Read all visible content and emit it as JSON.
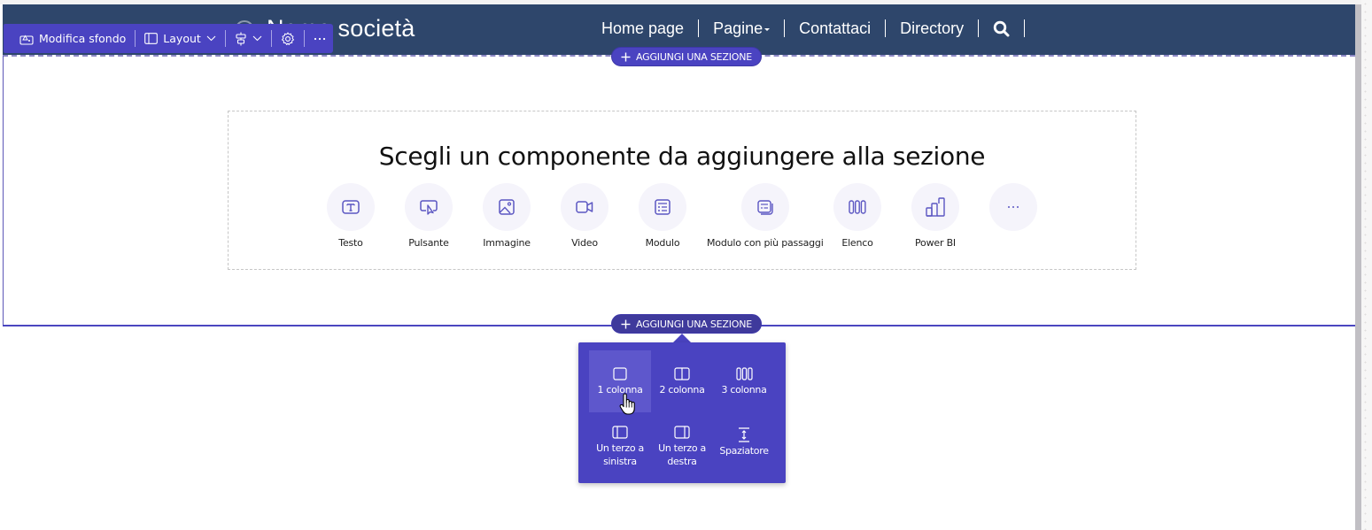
{
  "header": {
    "site_title": "Nome società",
    "site_title_visible": "società",
    "nav": [
      {
        "label": "Home page",
        "has_dropdown": false
      },
      {
        "label": "Pagine",
        "has_dropdown": true
      },
      {
        "label": "Contattaci",
        "has_dropdown": false
      },
      {
        "label": "Directory",
        "has_dropdown": false
      }
    ],
    "search_icon": "search-icon",
    "background_color": "#2e466b"
  },
  "edit_toolbar": {
    "edit_background_label": "Modifica sfondo",
    "layout_label": "Layout",
    "alignment_icon": "alignment-icon",
    "settings_icon": "gear-icon",
    "more_icon": "more-icon",
    "accent_color": "#4a43c1"
  },
  "add_section": {
    "label": "AGGIUNGI UNA SEZIONE"
  },
  "component_picker": {
    "title": "Scegli un componente da aggiungere alla sezione",
    "components": [
      {
        "label": "Testo",
        "icon": "text-icon"
      },
      {
        "label": "Pulsante",
        "icon": "button-icon"
      },
      {
        "label": "Immagine",
        "icon": "image-icon"
      },
      {
        "label": "Video",
        "icon": "video-icon"
      },
      {
        "label": "Modulo",
        "icon": "form-icon"
      },
      {
        "label": "Modulo con più passaggi",
        "icon": "multistep-form-icon"
      },
      {
        "label": "Elenco",
        "icon": "list-icon"
      },
      {
        "label": "Power BI",
        "icon": "power-bi-icon"
      },
      {
        "label": "",
        "icon": "more-icon"
      }
    ]
  },
  "layout_popup": {
    "options": [
      {
        "label": "1 colonna",
        "icon": "one-column-icon",
        "selected": true
      },
      {
        "label": "2 colonna",
        "icon": "two-column-icon",
        "selected": false
      },
      {
        "label": "3 colonna",
        "icon": "three-column-icon",
        "selected": false
      },
      {
        "label": "Un terzo a sinistra",
        "line1": "Un terzo a",
        "line2": "sinistra",
        "icon": "one-third-left-icon",
        "selected": false
      },
      {
        "label": "Un terzo a destra",
        "line1": "Un terzo a",
        "line2": "destra",
        "icon": "one-third-right-icon",
        "selected": false
      },
      {
        "label": "Spaziatore",
        "icon": "spacer-icon",
        "selected": false
      }
    ]
  }
}
